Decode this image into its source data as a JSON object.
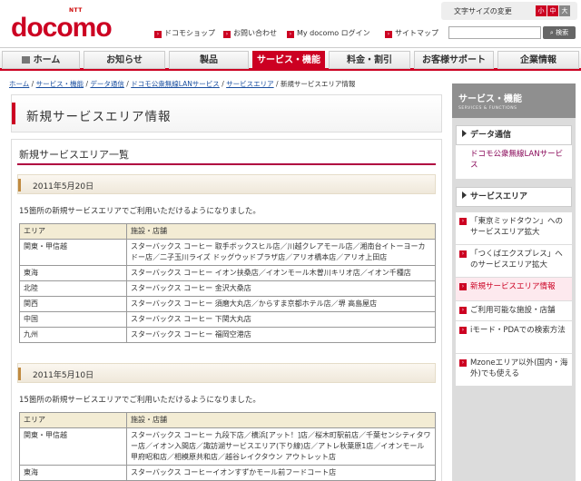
{
  "header": {
    "logo_ntt": "NTT",
    "logo_text": "docomo",
    "font_size": {
      "label": "文字サイズの変更",
      "small": "小",
      "medium": "中",
      "large": "大"
    },
    "links": [
      "ドコモショップ",
      "お問い合わせ",
      "My docomo ログイン",
      "サイトマップ"
    ],
    "search_placeholder": "",
    "search_button": "検索"
  },
  "nav": [
    "ホーム",
    "お知らせ",
    "製品",
    "サービス・機能",
    "料金・割引",
    "お客様サポート",
    "企業情報"
  ],
  "breadcrumb": {
    "items": [
      "ホーム",
      "サービス・機能",
      "データ通信",
      "ドコモ公衆無線LANサービス",
      "サービスエリア"
    ],
    "current": "新規サービスエリア情報",
    "separator": "/"
  },
  "main": {
    "page_title": "新規サービスエリア情報",
    "section_title": "新規サービスエリア一覧",
    "table_headers": [
      "エリア",
      "施設・店舗"
    ],
    "groups": [
      {
        "date": "2011年5月20日",
        "intro": "15箇所の新規サービスエリアでご利用いただけるようになりました。",
        "rows": [
          [
            "関東・甲信越",
            "スターバックス コーヒー 取手ボックスヒル店／川越クレアモール店／湘南台イトーヨーカドー店／二子玉川ライズ ドッグウッドプラザ店／アリオ橋本店／アリオ上田店"
          ],
          [
            "東海",
            "スターバックス コーヒー イオン扶桑店／イオンモール木曽川キリオ店／イオン千種店"
          ],
          [
            "北陸",
            "スターバックス コーヒー 金沢大桑店"
          ],
          [
            "関西",
            "スターバックス コーヒー 須磨大丸店／からすま京都ホテル店／堺 高島屋店"
          ],
          [
            "中国",
            "スターバックス コーヒー 下関大丸店"
          ],
          [
            "九州",
            "スターバックス コーヒー 福岡空港店"
          ]
        ]
      },
      {
        "date": "2011年5月10日",
        "intro": "15箇所の新規サービスエリアでご利用いただけるようになりました。",
        "rows": [
          [
            "関東・甲信越",
            "スターバックス コーヒー 九段下店／横浜[アット！]店／桜木町駅前店／千葉センシティタワー店／イオン入間店／諏訪湖サービスエリア(下り線)店／アトレ秋葉原1店／イオンモール甲府昭和店／相模原共和店／越谷レイクタウン アウトレット店"
          ],
          [
            "東海",
            "スターバックス コーヒーイオンすずかモール前フードコート店"
          ]
        ]
      }
    ]
  },
  "sidebar": {
    "title": "サービス・機能",
    "subtitle": "SERVICES & FUNCTIONS",
    "cat1": "データ通信",
    "link1": "ドコモ公衆無線LANサービス",
    "cat2": "サービスエリア",
    "items": [
      "「東京ミッドタウン」へのサービスエリア拡大",
      "「つくばエクスプレス」へのサービスエリア拡大",
      "新規サービスエリア情報",
      "ご利用可能な施設・店舗",
      "iモード・PDAでの検索方法",
      "Mzoneエリア以外(国内・海外)でも使える"
    ]
  },
  "colors": {
    "brand": "#cc0022",
    "accent_link": "#8a0a5a",
    "rule": "#b00040"
  }
}
